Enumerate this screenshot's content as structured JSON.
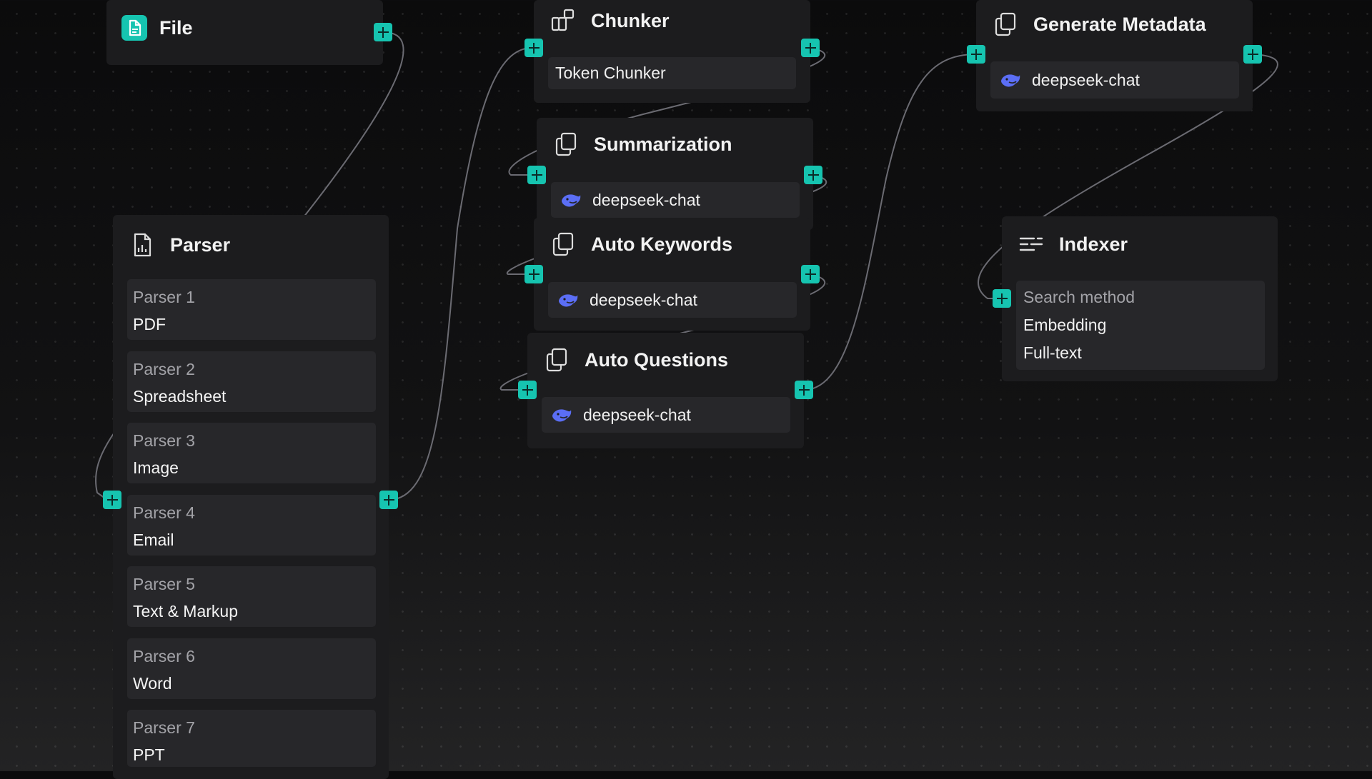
{
  "nodes": {
    "file": {
      "title": "File",
      "icon": "file-icon"
    },
    "parser": {
      "title": "Parser",
      "icon": "document-chart-icon",
      "items": [
        {
          "label": "Parser 1",
          "value": "PDF"
        },
        {
          "label": "Parser 2",
          "value": "Spreadsheet"
        },
        {
          "label": "Parser 3",
          "value": "Image"
        },
        {
          "label": "Parser 4",
          "value": "Email"
        },
        {
          "label": "Parser 5",
          "value": "Text & Markup"
        },
        {
          "label": "Parser 6",
          "value": "Word"
        },
        {
          "label": "Parser 7",
          "value": "PPT"
        }
      ]
    },
    "chunker": {
      "title": "Chunker",
      "icon": "grid-blocks-icon",
      "value": "Token Chunker"
    },
    "summarization": {
      "title": "Summarization",
      "icon": "copy-icon",
      "model": "deepseek-chat"
    },
    "auto_keywords": {
      "title": "Auto Keywords",
      "icon": "copy-icon",
      "model": "deepseek-chat"
    },
    "auto_questions": {
      "title": "Auto Questions",
      "icon": "copy-icon",
      "model": "deepseek-chat"
    },
    "generate_metadata": {
      "title": "Generate Metadata",
      "icon": "copy-icon",
      "model": "deepseek-chat"
    },
    "indexer": {
      "title": "Indexer",
      "icon": "indexer-lines-icon",
      "label": "Search method",
      "methods": [
        "Embedding",
        "Full-text"
      ]
    }
  },
  "colors": {
    "accent": "#16c4b0",
    "node_bg": "#1c1c1e",
    "field_bg": "#27272a",
    "edge": "#6b6b72",
    "model_icon": "#5b6ef5"
  }
}
